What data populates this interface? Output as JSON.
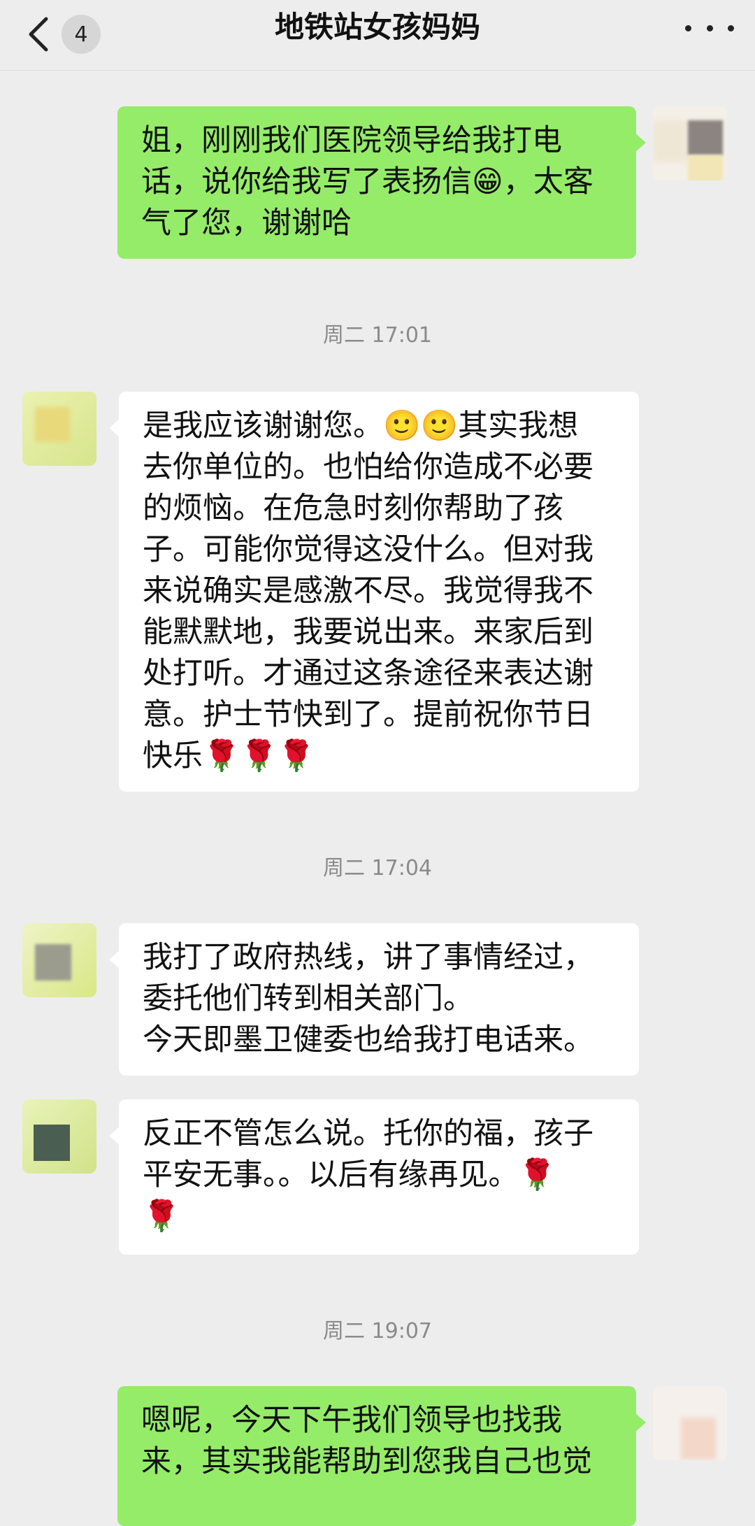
{
  "navbar": {
    "unread_count": "4",
    "title": "地铁站女孩妈妈"
  },
  "messages": [
    {
      "side": "sent",
      "text": "姐，刚刚我们医院领导给我打电\n话，说你给我写了表扬信😁，太客\n气了您，谢谢哈"
    },
    {
      "timestamp": "周二 17:01"
    },
    {
      "side": "recv",
      "text": "是我应该谢谢您。🙂🙂其实我想\n去你单位的。也怕给你造成不必要\n的烦恼。在危急时刻你帮助了孩\n子。可能你觉得这没什么。但对我\n来说确实是感激不尽。我觉得我不\n能默默地，我要说出来。来家后到\n处打听。才通过这条途径来表达谢\n意。护士节快到了。提前祝你节日\n快乐🌹🌹🌹"
    },
    {
      "timestamp": "周二 17:04"
    },
    {
      "side": "recv",
      "text": "我打了政府热线，讲了事情经过，\n委托他们转到相关部门。\n今天即墨卫健委也给我打电话来。"
    },
    {
      "side": "recv",
      "text": "反正不管怎么说。托你的福，孩子\n平安无事。。以后有缘再见。🌹\n🌹"
    },
    {
      "timestamp": "周二 19:07"
    },
    {
      "side": "sent",
      "text": "嗯呢，今天下午我们领导也找我\n来，其实我能帮助到您我自己也觉"
    }
  ],
  "icons": {
    "back": "chevron-left-icon",
    "more": "more-dots-icon"
  },
  "colors": {
    "background": "#ededed",
    "sent_bubble": "#95ec69",
    "recv_bubble": "#ffffff",
    "timestamp": "#8a8a8a"
  }
}
